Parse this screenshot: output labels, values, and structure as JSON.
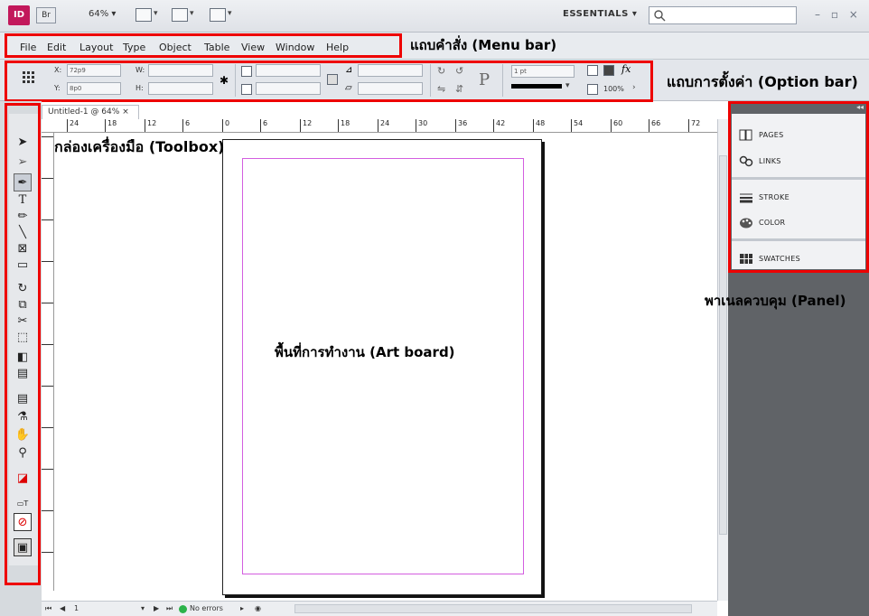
{
  "app": {
    "logo_text": "ID",
    "bridge_text": "Br",
    "zoom": "64%",
    "workspace": "ESSENTIALS",
    "window_controls": "– ▫ ×"
  },
  "menu": {
    "items": [
      "File",
      "Edit",
      "Layout",
      "Type",
      "Object",
      "Table",
      "View",
      "Window",
      "Help"
    ]
  },
  "options": {
    "x_label": "X:",
    "x_value": "72p9",
    "y_label": "Y:",
    "y_value": "8p0",
    "w_label": "W:",
    "h_label": "H:",
    "stroke_weight": "1 pt",
    "opacity": "100%"
  },
  "document": {
    "tab_title": "Untitled-1 @ 64%",
    "status": "No errors",
    "page_num": "1"
  },
  "ruler": {
    "h_ticks": [
      "24",
      "18",
      "12",
      "6",
      "0",
      "6",
      "12",
      "18",
      "24",
      "30",
      "36",
      "42",
      "48",
      "54",
      "60",
      "66",
      "72"
    ]
  },
  "panel": {
    "items": [
      "PAGES",
      "LINKS",
      "STROKE",
      "COLOR",
      "SWATCHES"
    ]
  },
  "annotations": {
    "menu_bar": "แถบคำสั่ง (Menu bar)",
    "option_bar": "แถบการตั้งค่า (Option bar)",
    "toolbox": "กล่องเครื่องมือ (Toolbox)",
    "panel": "พาเนลควบคุม (Panel)",
    "art_board": "พื้นที่การทำงาน (Art board)"
  },
  "colors": {
    "highlight": "#e00000",
    "margin_guide": "#d35ee0",
    "logo": "#c2185b"
  }
}
